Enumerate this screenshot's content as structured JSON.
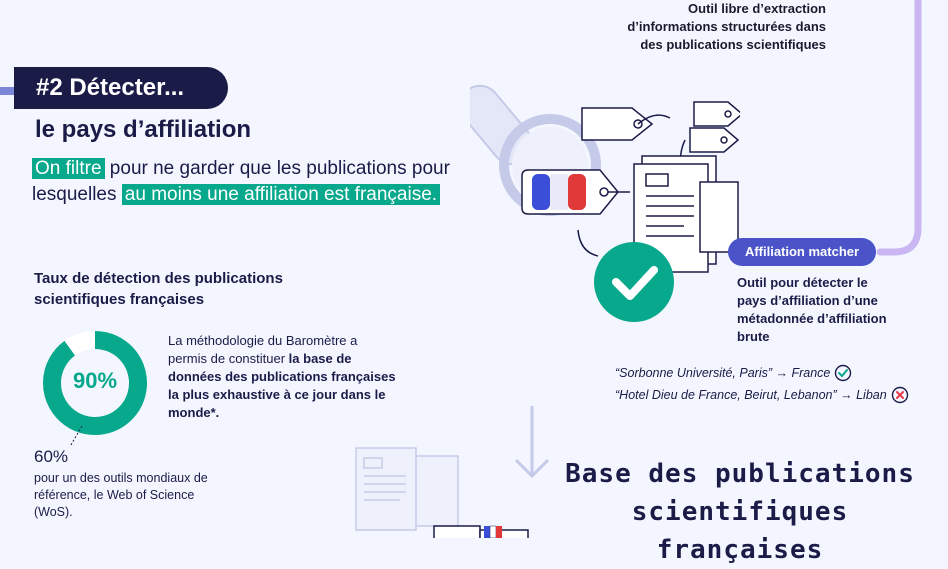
{
  "top_note": {
    "lines": [
      "Outil libre d’extraction",
      "d’informations structurées dans",
      "des publications scientifiques"
    ]
  },
  "step": {
    "pill_label": "#2 Détecter...",
    "subtitle": "le pays d’affiliation"
  },
  "lead": {
    "hl1": "On filtre",
    "text1": " pour ne garder que les publications pour lesquelles ",
    "hl2": "au moins une affiliation est française."
  },
  "rate": {
    "title": "Taux de détection des publications scientifiques françaises",
    "percent_label": "90%",
    "percent_value": 90,
    "method_plain": "La méthodologie du Baromètre a permis de constituer ",
    "method_bold": "la base de données des publications françaises la plus exhaustive à ce jour dans le monde*.",
    "wos_value": "60%",
    "wos_desc": "pour un des outils mondiaux de référence, le Web of Science (WoS)."
  },
  "matcher": {
    "badge": "Affiliation matcher",
    "desc": "Outil pour détecter le pays d’affiliation d’une métadonnée d’affiliation brute"
  },
  "examples": [
    {
      "text": "“Sorbonne Université, Paris” → France",
      "status": "check-icon"
    },
    {
      "text": "“Hotel Dieu de France, Beirut, Lebanon” → Liban",
      "status": "cross-icon"
    }
  ],
  "base": {
    "title": "Base des publications scientifiques françaises"
  },
  "colors": {
    "navy": "#1b1b48",
    "green": "#07a88c",
    "purple": "#c9b6f3",
    "blue_badge": "#4b53c9",
    "french_blue": "#3b4ed8",
    "french_red": "#e1393a",
    "red_cross": "#e8374a"
  }
}
